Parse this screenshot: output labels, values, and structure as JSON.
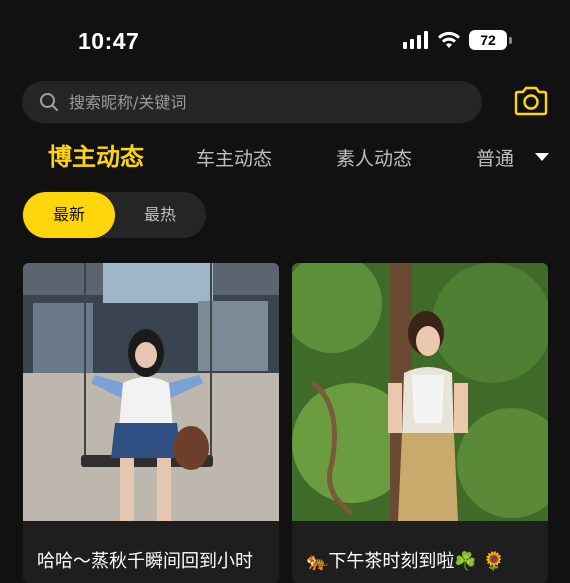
{
  "status": {
    "time": "10:47",
    "battery": "72"
  },
  "search": {
    "placeholder": "搜索昵称/关键词"
  },
  "tabs": [
    {
      "label": "博主动态"
    },
    {
      "label": "车主动态"
    },
    {
      "label": "素人动态"
    },
    {
      "label": "普通"
    }
  ],
  "sort": {
    "latest": "最新",
    "hottest": "最热"
  },
  "posts": [
    {
      "title": "哈哈～蒸秋千瞬间回到小时"
    },
    {
      "title_emoji_start": "🐅",
      "title": "下午茶时刻到啦",
      "title_emoji_end": "☘️ 🌻"
    }
  ],
  "colors": {
    "accent": "#ffd60a",
    "background": "#111111",
    "surface": "#252525"
  },
  "icons": [
    "search-icon",
    "camera-icon",
    "signal-icon",
    "wifi-icon",
    "battery-icon",
    "dropdown-arrow-icon"
  ]
}
